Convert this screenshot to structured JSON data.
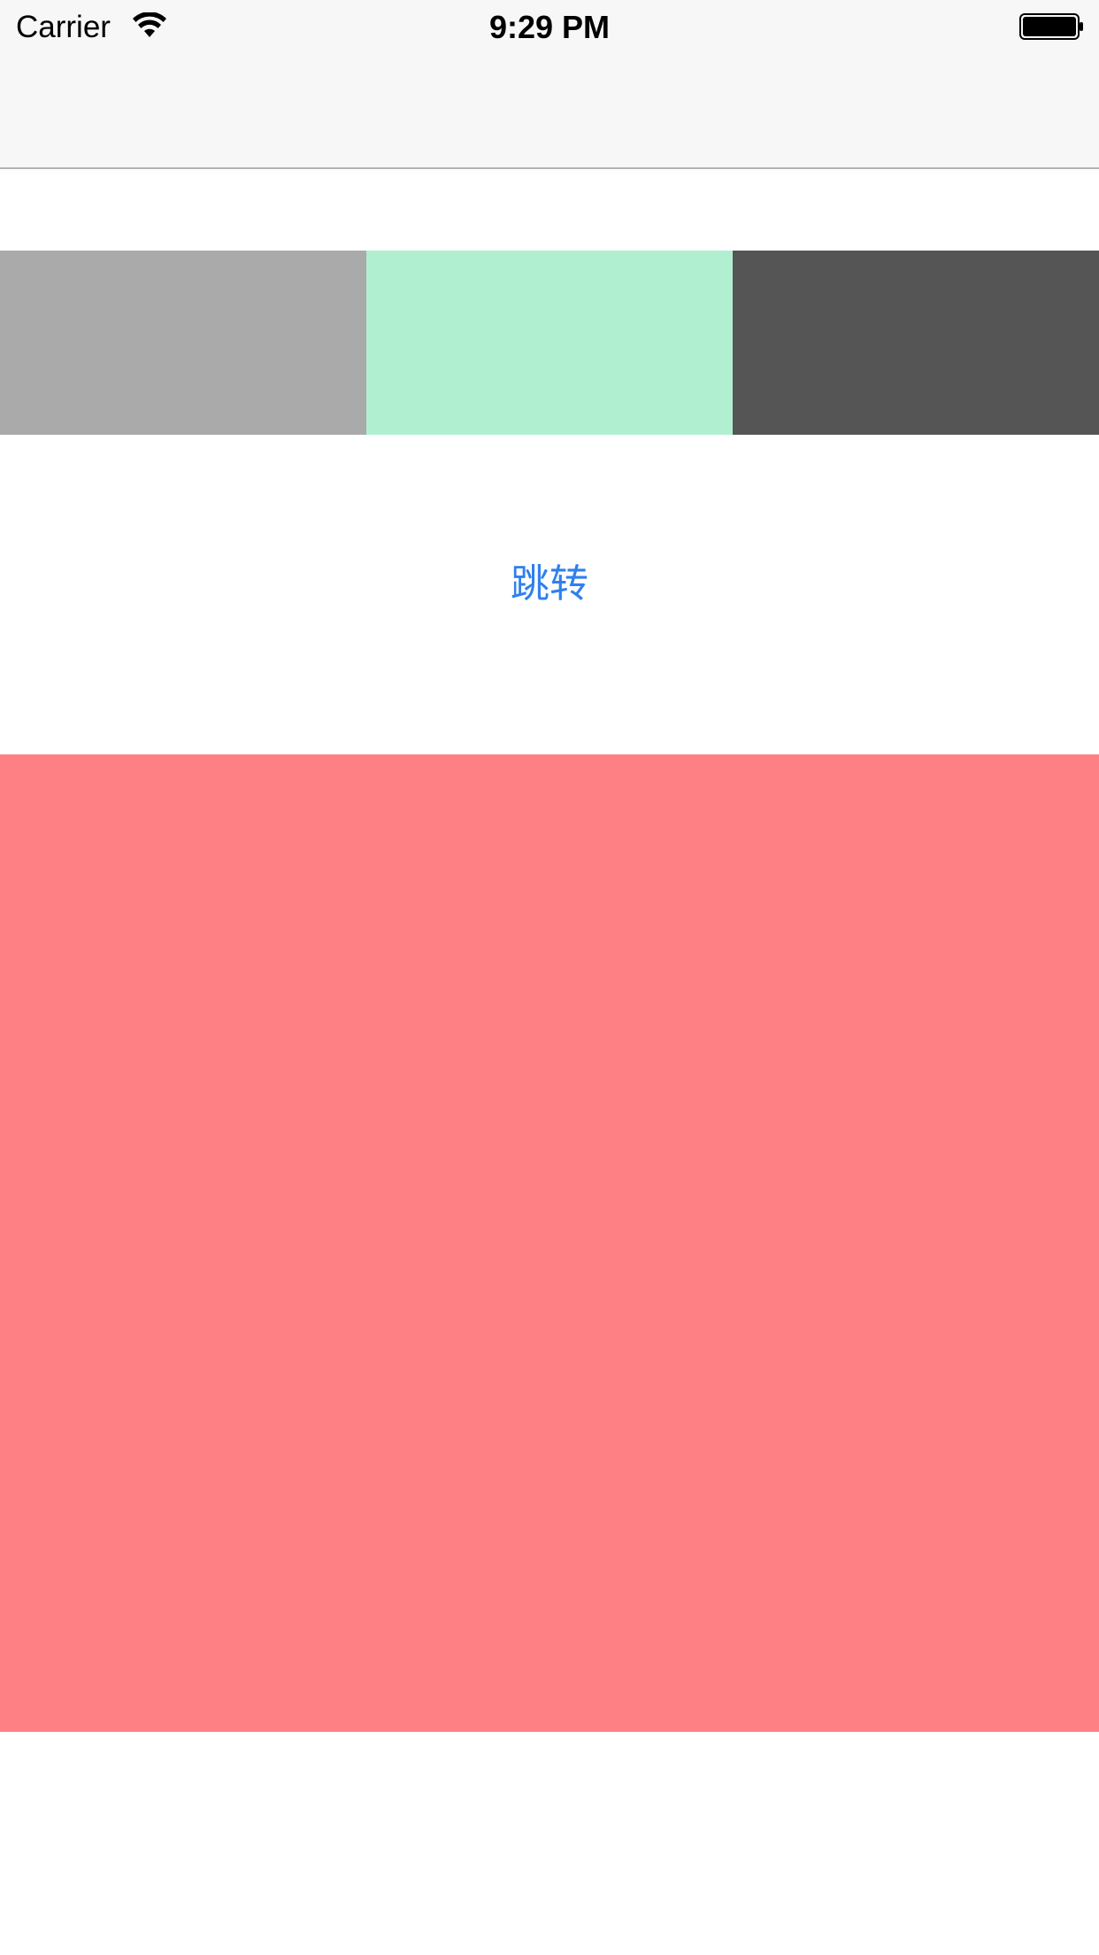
{
  "status_bar": {
    "carrier": "Carrier",
    "time": "9:29 PM",
    "wifi_icon": "wifi-icon",
    "battery_icon": "battery-icon"
  },
  "color_strip": {
    "colors": [
      "#aaaaaa",
      "#b0f0d1",
      "#555555"
    ]
  },
  "main": {
    "jump_label": "跳转",
    "jump_color": "#2f80ed"
  },
  "red_panel": {
    "color": "#ff8084"
  }
}
